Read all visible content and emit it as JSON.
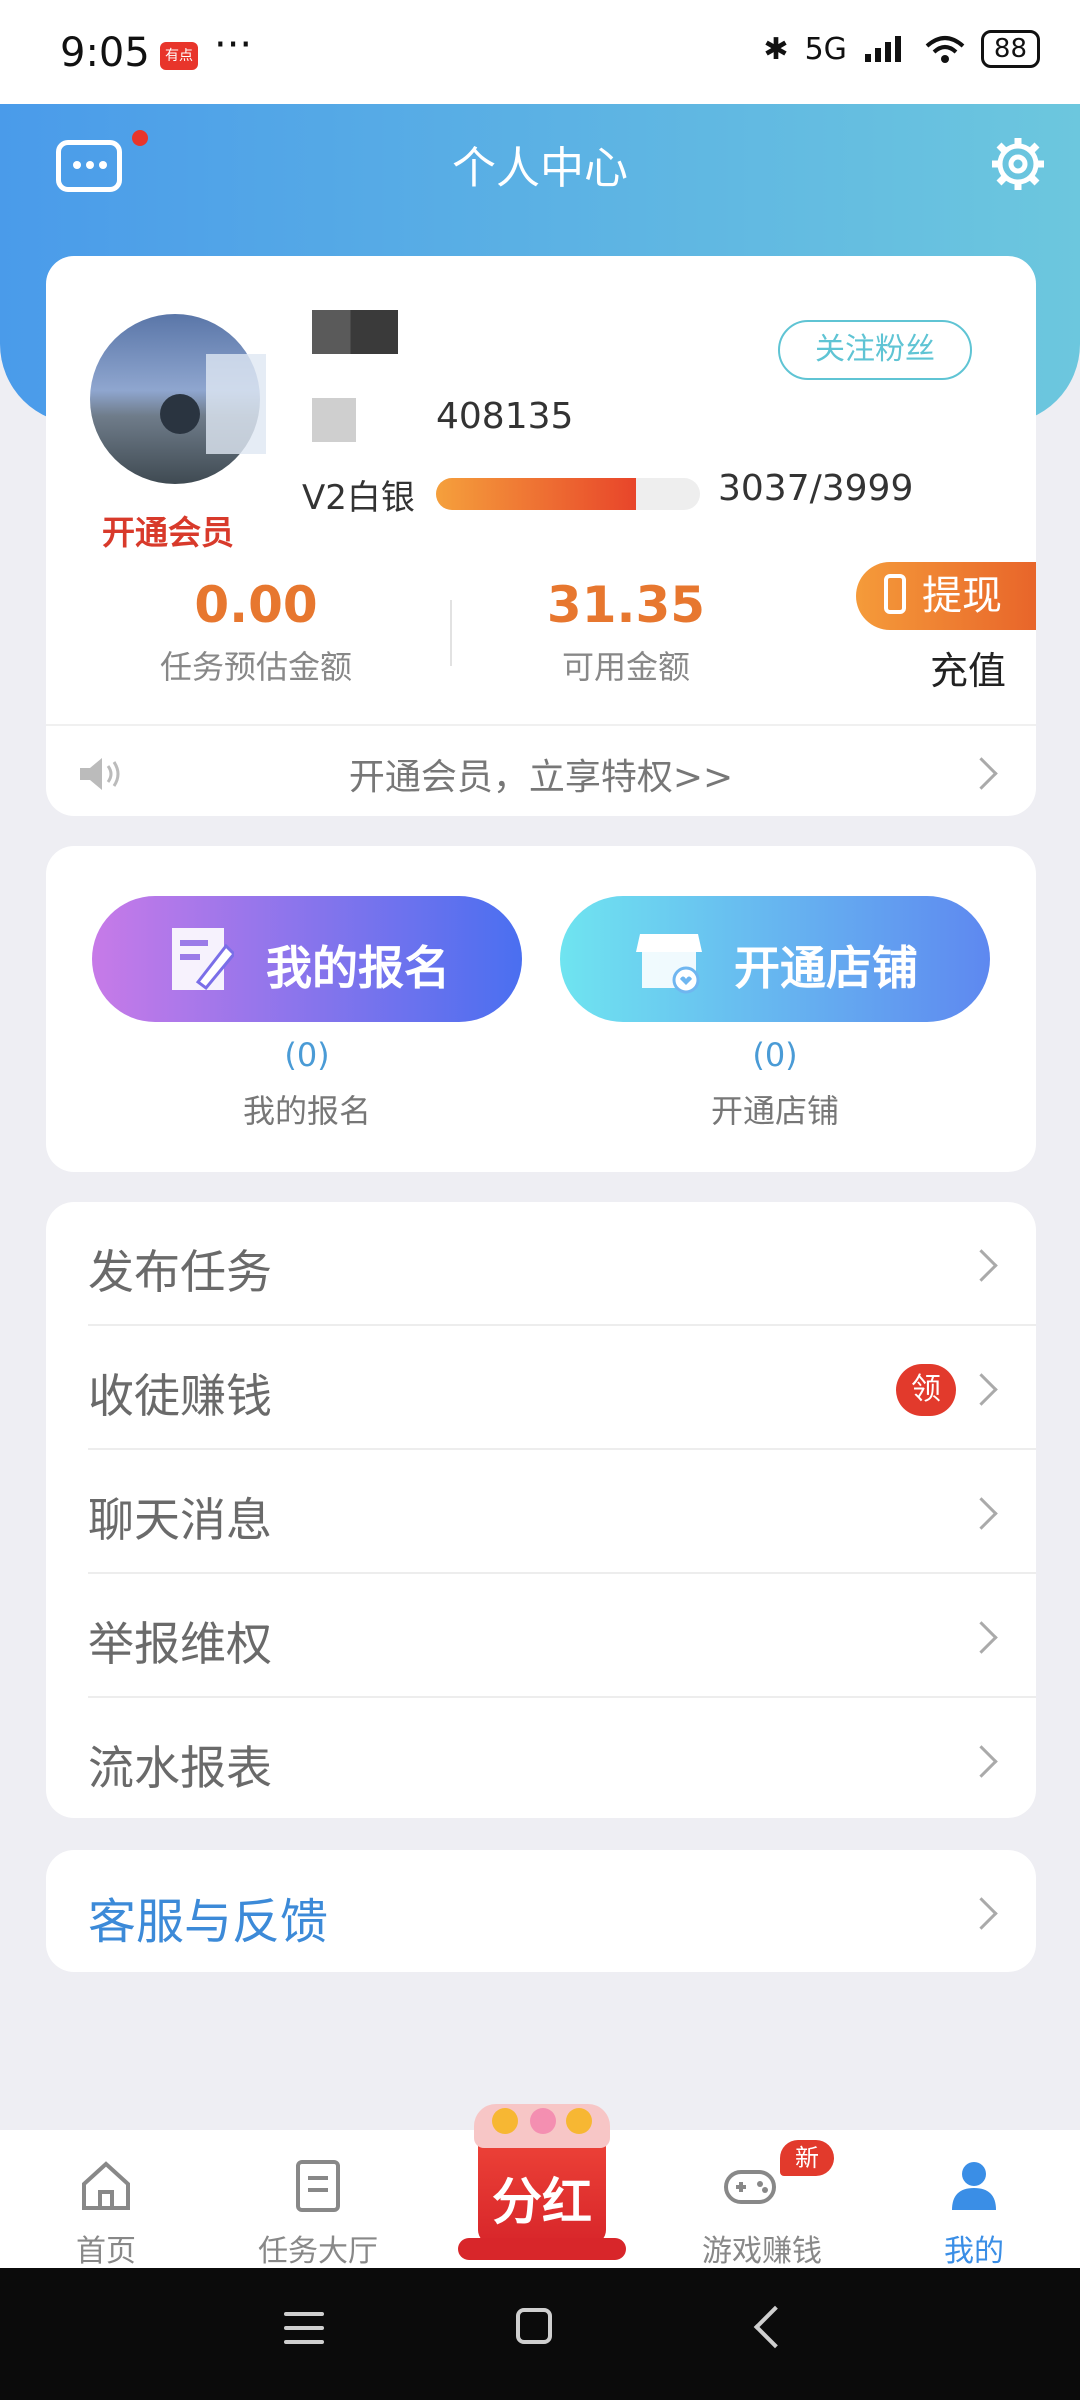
{
  "status_bar": {
    "time": "9:05",
    "app_badge": "有点",
    "more": "···",
    "network": "5G",
    "battery": "88"
  },
  "header": {
    "title": "个人中心"
  },
  "profile": {
    "open_vip_label": "开通会员",
    "user_id": "408135",
    "follow_button": "关注粉丝",
    "level_name": "V2白银",
    "level_progress": 0.759,
    "experience": "3037/3999",
    "stats": [
      {
        "value": "0.00",
        "label": "任务预估金额"
      },
      {
        "value": "31.35",
        "label": "可用金额"
      }
    ],
    "withdraw_button": "提现",
    "recharge_link": "充值",
    "notice": "开通会员，立享特权>>"
  },
  "quick_actions": [
    {
      "button_label": "我的报名",
      "count": "(0)",
      "caption": "我的报名"
    },
    {
      "button_label": "开通店铺",
      "count": "(0)",
      "caption": "开通店铺"
    }
  ],
  "menu": {
    "items": [
      "发布任务",
      "收徒赚钱",
      "聊天消息",
      "举报维权",
      "流水报表"
    ],
    "badge": "领"
  },
  "service": {
    "label": "客服与反馈"
  },
  "tabbar": {
    "tabs": [
      "首页",
      "任务大厅",
      "游戏赚钱",
      "我的"
    ],
    "center": "分红",
    "new_badge": "新",
    "active_color": "#3a8ee6"
  },
  "colors": {
    "accent": "#4a9bea",
    "money": "#e7772f",
    "vip": "#d83a2b"
  }
}
